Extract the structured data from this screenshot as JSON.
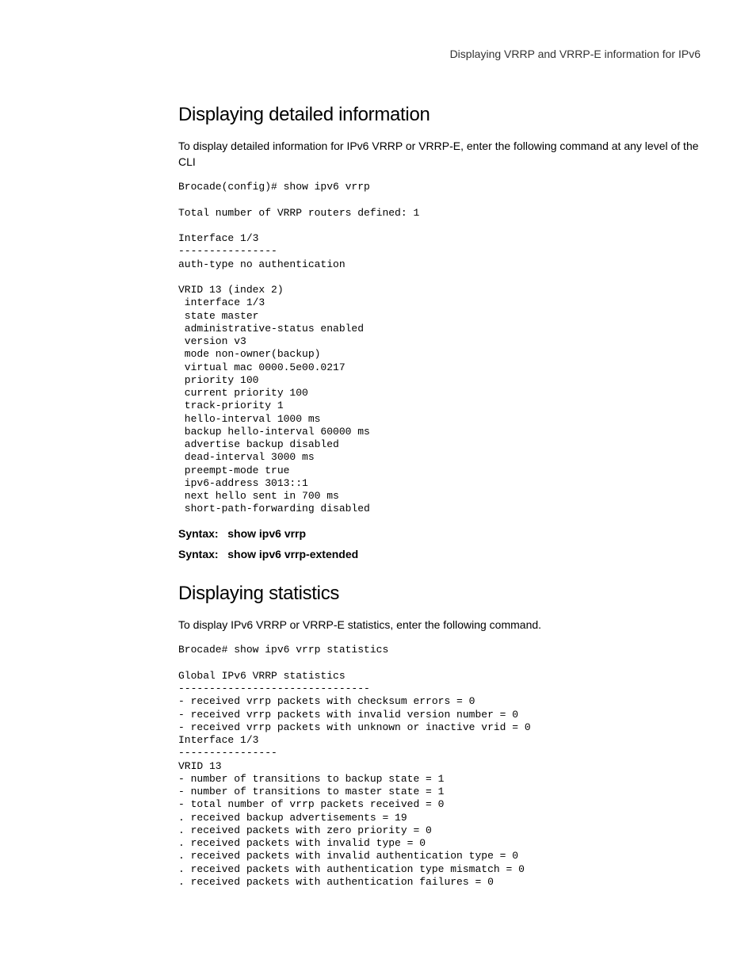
{
  "running_header": "Displaying VRRP and VRRP-E information for IPv6",
  "section1": {
    "heading": "Displaying detailed information",
    "intro": "To display detailed information for IPv6 VRRP or VRRP-E, enter the following command at any level of the CLI",
    "code": "Brocade(config)# show ipv6 vrrp\n\nTotal number of VRRP routers defined: 1\n\nInterface 1/3\n----------------\nauth-type no authentication\n\nVRID 13 (index 2)\n interface 1/3\n state master\n administrative-status enabled\n version v3\n mode non-owner(backup)\n virtual mac 0000.5e00.0217\n priority 100\n current priority 100\n track-priority 1\n hello-interval 1000 ms\n backup hello-interval 60000 ms\n advertise backup disabled\n dead-interval 3000 ms\n preempt-mode true\n ipv6-address 3013::1\n next hello sent in 700 ms\n short-path-forwarding disabled",
    "syntax1_label": "Syntax:",
    "syntax1_cmd": "show ipv6 vrrp",
    "syntax2_label": "Syntax:",
    "syntax2_cmd": "show ipv6 vrrp-extended"
  },
  "section2": {
    "heading": "Displaying statistics",
    "intro": "To display IPv6 VRRP or VRRP-E statistics, enter the following command.",
    "code": "Brocade# show ipv6 vrrp statistics\n\nGlobal IPv6 VRRP statistics\n-------------------------------\n- received vrrp packets with checksum errors = 0\n- received vrrp packets with invalid version number = 0\n- received vrrp packets with unknown or inactive vrid = 0\nInterface 1/3\n----------------\nVRID 13\n- number of transitions to backup state = 1\n- number of transitions to master state = 1\n- total number of vrrp packets received = 0\n. received backup advertisements = 19\n. received packets with zero priority = 0\n. received packets with invalid type = 0\n. received packets with invalid authentication type = 0\n. received packets with authentication type mismatch = 0\n. received packets with authentication failures = 0"
  }
}
